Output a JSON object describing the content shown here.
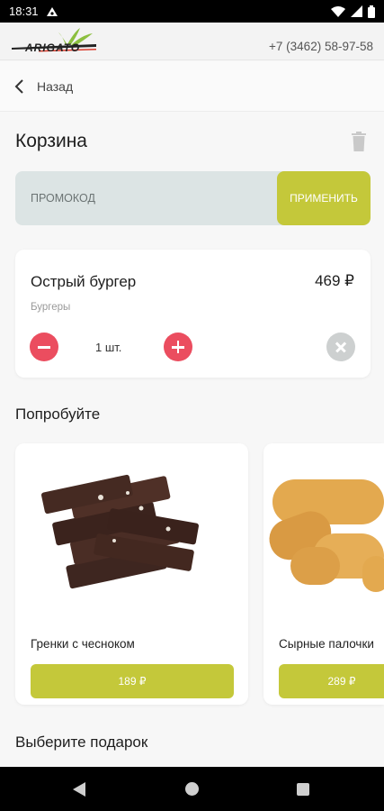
{
  "status_bar": {
    "time": "18:31"
  },
  "header": {
    "logo_text": "ARIGATO",
    "phone": "+7 (3462) 58-97-58"
  },
  "nav": {
    "back_label": "Назад"
  },
  "cart": {
    "title": "Корзина",
    "promo_placeholder": "ПРОМОКОД",
    "promo_button": "ПРИМЕНИТЬ",
    "items": [
      {
        "name": "Острый бургер",
        "price": "469 ₽",
        "category": "Бургеры",
        "quantity": "1 шт."
      }
    ]
  },
  "suggestions": {
    "title": "Попробуйте",
    "products": [
      {
        "name": "Гренки с чесноком",
        "price": "189 ₽"
      },
      {
        "name": "Сырные палочки",
        "price": "289 ₽"
      }
    ]
  },
  "gift": {
    "title": "Выберите подарок"
  },
  "colors": {
    "accent": "#c4c83a",
    "minus_plus": "#eb4d5f",
    "remove": "#cdd0d0",
    "promo_bg": "#dce4e4"
  }
}
